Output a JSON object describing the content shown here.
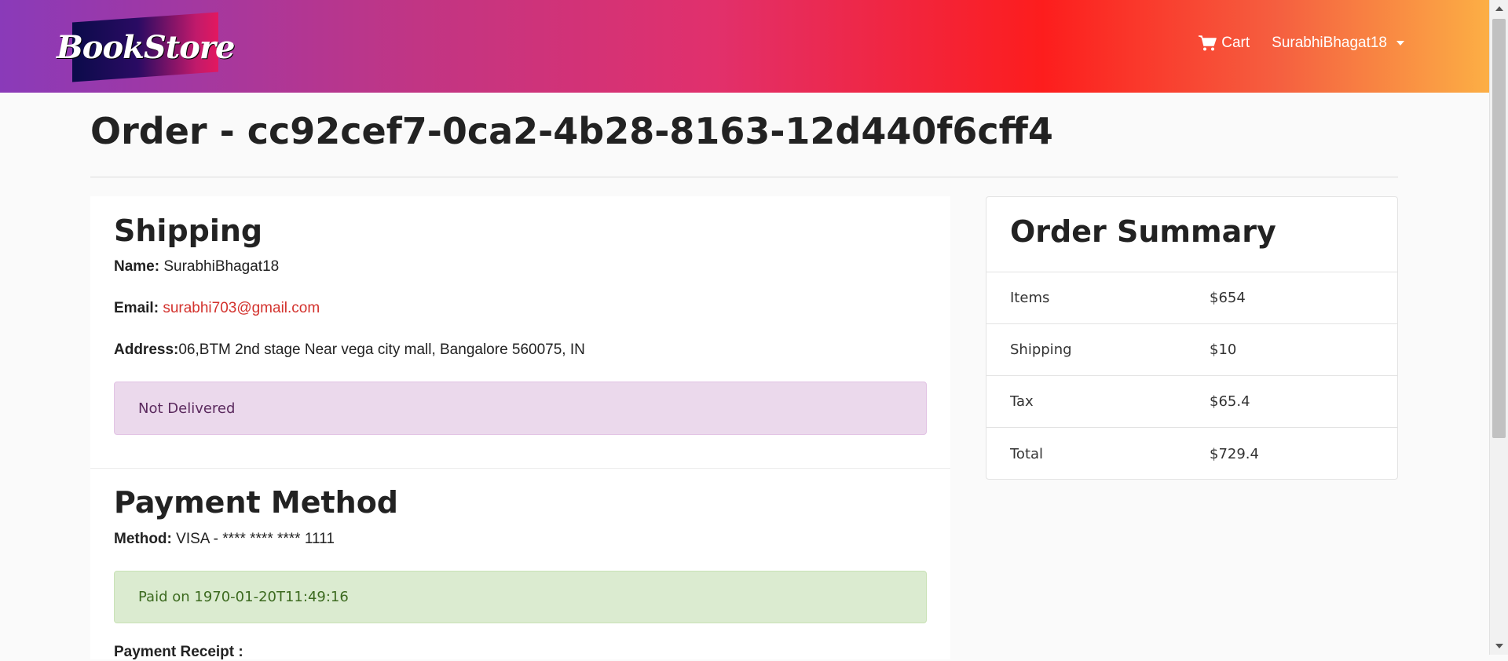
{
  "navbar": {
    "brand": "BookStore",
    "cart_label": "Cart",
    "user_label": "SurabhiBhagat18"
  },
  "page": {
    "title": "Order - cc92cef7-0ca2-4b28-8163-12d440f6cff4"
  },
  "shipping": {
    "heading": "Shipping",
    "name_label": "Name:",
    "name_value": "SurabhiBhagat18",
    "email_label": "Email:",
    "email_value": "surabhi703@gmail.com",
    "address_label": "Address:",
    "address_value": "06,BTM 2nd stage Near vega city mall, Bangalore 560075, IN",
    "delivery_status": "Not Delivered"
  },
  "payment": {
    "heading": "Payment Method",
    "method_label": "Method:",
    "method_value": "VISA - **** **** **** 1111",
    "paid_status": "Paid on 1970-01-20T11:49:16",
    "receipt_label": "Payment Receipt :"
  },
  "summary": {
    "heading": "Order Summary",
    "rows": [
      {
        "label": "Items",
        "value": "$654"
      },
      {
        "label": "Shipping",
        "value": "$10"
      },
      {
        "label": "Tax",
        "value": "$65.4"
      },
      {
        "label": "Total",
        "value": "$729.4"
      }
    ]
  },
  "colors": {
    "email_link": "#d3322d",
    "alert_not_delivered_bg": "#ebd9ec",
    "alert_paid_bg": "#dbebd0"
  }
}
